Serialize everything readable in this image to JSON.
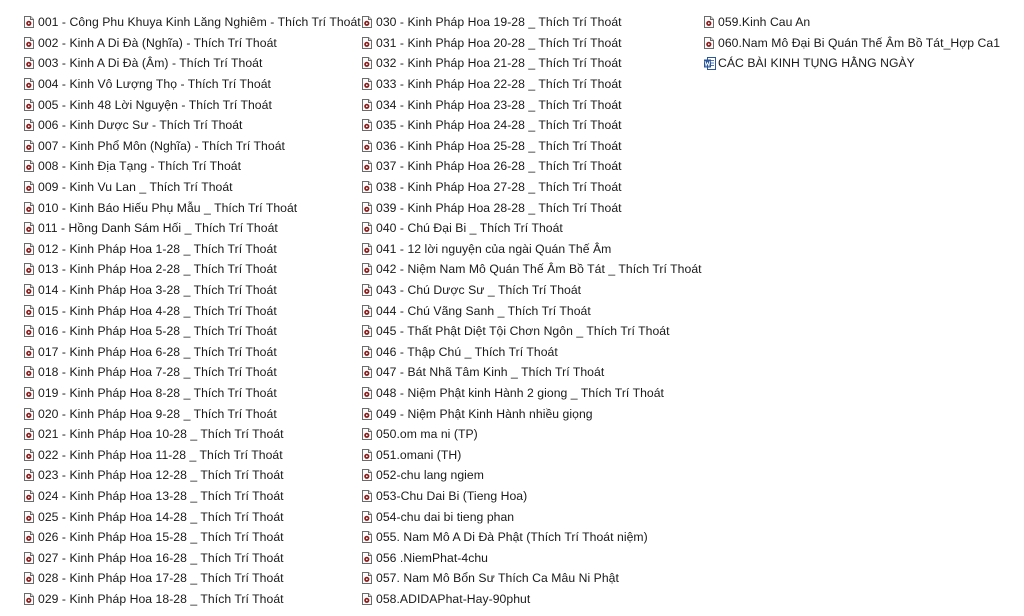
{
  "file_list": {
    "columns": [
      {
        "items": [
          {
            "name": "001 - Công Phu Khuya Kinh Lăng Nghiêm - Thích Trí Thoát",
            "icon": "audio-file-icon"
          },
          {
            "name": "002 - Kinh A Di Đà (Nghĩa) - Thích Trí Thoát",
            "icon": "audio-file-icon"
          },
          {
            "name": "003 - Kinh A Di Đà (Âm) - Thích Trí Thoát",
            "icon": "audio-file-icon"
          },
          {
            "name": "004 - Kinh Vô Lượng Thọ  - Thích Trí Thoát",
            "icon": "audio-file-icon"
          },
          {
            "name": "005 - Kinh 48 Lời Nguyện - Thích Trí Thoát",
            "icon": "audio-file-icon"
          },
          {
            "name": "006 - Kinh Dược Sư - Thích Trí Thoát",
            "icon": "audio-file-icon"
          },
          {
            "name": "007 - Kinh Phổ Môn (Nghĩa) - Thích Trí Thoát",
            "icon": "audio-file-icon"
          },
          {
            "name": "008 - Kinh Địa Tạng - Thích Trí Thoát",
            "icon": "audio-file-icon"
          },
          {
            "name": "009 - Kinh Vu Lan _ Thích Trí Thoát",
            "icon": "audio-file-icon"
          },
          {
            "name": "010 - Kinh Báo Hiếu Phụ Mẫu _ Thích Trí Thoát",
            "icon": "audio-file-icon"
          },
          {
            "name": "011 - Hồng Danh Sám Hối _ Thích Trí Thoát",
            "icon": "audio-file-icon"
          },
          {
            "name": "012 - Kinh Pháp Hoa 1-28 _ Thích Trí Thoát",
            "icon": "audio-file-icon"
          },
          {
            "name": "013 - Kinh Pháp Hoa 2-28 _ Thích Trí Thoát",
            "icon": "audio-file-icon"
          },
          {
            "name": "014 - Kinh Pháp Hoa 3-28 _ Thích Trí Thoát",
            "icon": "audio-file-icon"
          },
          {
            "name": "015 - Kinh Pháp Hoa 4-28 _ Thích Trí Thoát",
            "icon": "audio-file-icon"
          },
          {
            "name": "016 - Kinh Pháp Hoa 5-28 _ Thích Trí Thoát",
            "icon": "audio-file-icon"
          },
          {
            "name": "017 - Kinh Pháp Hoa 6-28 _ Thích Trí Thoát",
            "icon": "audio-file-icon"
          },
          {
            "name": "018 - Kinh Pháp Hoa 7-28 _ Thích Trí Thoát",
            "icon": "audio-file-icon"
          },
          {
            "name": "019 - Kinh Pháp Hoa 8-28 _ Thích Trí Thoát",
            "icon": "audio-file-icon"
          },
          {
            "name": "020 - Kinh Pháp Hoa 9-28 _ Thích Trí Thoát",
            "icon": "audio-file-icon"
          },
          {
            "name": "021 - Kinh Pháp Hoa 10-28 _ Thích Trí Thoát",
            "icon": "audio-file-icon"
          },
          {
            "name": "022 - Kinh Pháp Hoa 11-28 _ Thích Trí Thoát",
            "icon": "audio-file-icon"
          },
          {
            "name": "023 - Kinh Pháp Hoa 12-28 _ Thích Trí Thoát",
            "icon": "audio-file-icon"
          },
          {
            "name": "024 - Kinh Pháp Hoa 13-28 _ Thích Trí Thoát",
            "icon": "audio-file-icon"
          },
          {
            "name": "025 - Kinh Pháp Hoa 14-28 _ Thích Trí Thoát",
            "icon": "audio-file-icon"
          },
          {
            "name": "026 - Kinh Pháp Hoa 15-28 _ Thích Trí Thoát",
            "icon": "audio-file-icon"
          },
          {
            "name": "027 - Kinh Pháp Hoa 16-28 _ Thích Trí Thoát",
            "icon": "audio-file-icon"
          },
          {
            "name": "028 - Kinh Pháp Hoa 17-28 _ Thích Trí Thoát",
            "icon": "audio-file-icon"
          },
          {
            "name": "029 - Kinh Pháp Hoa 18-28 _ Thích Trí Thoát",
            "icon": "audio-file-icon"
          }
        ]
      },
      {
        "items": [
          {
            "name": "030 - Kinh Pháp Hoa 19-28 _ Thích Trí Thoát",
            "icon": "audio-file-icon"
          },
          {
            "name": "031 - Kinh Pháp Hoa 20-28 _ Thích Trí Thoát",
            "icon": "audio-file-icon"
          },
          {
            "name": "032 - Kinh Pháp Hoa 21-28 _ Thích Trí Thoát",
            "icon": "audio-file-icon"
          },
          {
            "name": "033 - Kinh Pháp Hoa 22-28 _ Thích Trí Thoát",
            "icon": "audio-file-icon"
          },
          {
            "name": "034 - Kinh Pháp Hoa 23-28 _ Thích Trí Thoát",
            "icon": "audio-file-icon"
          },
          {
            "name": "035 - Kinh Pháp Hoa 24-28 _ Thích Trí Thoát",
            "icon": "audio-file-icon"
          },
          {
            "name": "036 - Kinh Pháp Hoa 25-28 _ Thích Trí Thoát",
            "icon": "audio-file-icon"
          },
          {
            "name": "037 - Kinh Pháp Hoa 26-28 _ Thích Trí Thoát",
            "icon": "audio-file-icon"
          },
          {
            "name": "038 - Kinh Pháp Hoa 27-28 _ Thích Trí Thoát",
            "icon": "audio-file-icon"
          },
          {
            "name": "039 - Kinh Pháp Hoa 28-28 _ Thích Trí Thoát",
            "icon": "audio-file-icon"
          },
          {
            "name": "040 - Chú Đại Bi _ Thích Trí Thoát",
            "icon": "audio-file-icon"
          },
          {
            "name": "041 - 12 lời nguyện của ngài Quán Thế Âm",
            "icon": "audio-file-icon"
          },
          {
            "name": "042 - Niệm Nam Mô Quán Thế Âm Bồ Tát _ Thích Trí Thoát",
            "icon": "audio-file-icon"
          },
          {
            "name": "043 - Chú Dược Sư _ Thích Trí Thoát",
            "icon": "audio-file-icon"
          },
          {
            "name": "044 - Chú Vãng Sanh  _ Thích Trí Thoát",
            "icon": "audio-file-icon"
          },
          {
            "name": "045 - Thất Phật Diệt Tội Chơn Ngôn _ Thích Trí Thoát",
            "icon": "audio-file-icon"
          },
          {
            "name": "046 - Thập Chú _ Thích Trí Thoát",
            "icon": "audio-file-icon"
          },
          {
            "name": "047 - Bát Nhã Tâm Kinh _ Thích Trí Thoát",
            "icon": "audio-file-icon"
          },
          {
            "name": "048 - Niệm Phật kinh Hành 2 giong _ Thích Trí Thoát",
            "icon": "audio-file-icon"
          },
          {
            "name": "049 - Niệm Phật Kinh Hành nhiều giọng",
            "icon": "audio-file-icon"
          },
          {
            "name": "050.om ma ni (TP)",
            "icon": "audio-file-icon"
          },
          {
            "name": "051.omani (TH)",
            "icon": "audio-file-icon"
          },
          {
            "name": "052-chu lang ngiem",
            "icon": "audio-file-icon"
          },
          {
            "name": "053-Chu Dai Bi (Tieng Hoa)",
            "icon": "audio-file-icon"
          },
          {
            "name": "054-chu dai bi tieng phan",
            "icon": "audio-file-icon"
          },
          {
            "name": "055. Nam Mô A Di Đà Phật (Thích Trí Thoát niệm)",
            "icon": "audio-file-icon"
          },
          {
            "name": "056 .NiemPhat-4chu",
            "icon": "audio-file-icon"
          },
          {
            "name": "057. Nam Mô Bổn Sư Thích Ca Mâu Ni Phật",
            "icon": "audio-file-icon"
          },
          {
            "name": "058.ADIDAPhat-Hay-90phut",
            "icon": "audio-file-icon"
          }
        ]
      },
      {
        "items": [
          {
            "name": "059.Kinh Cau An",
            "icon": "audio-file-icon"
          },
          {
            "name": "060.Nam Mô Đại Bi Quán Thế Âm Bồ Tát_Hợp Ca1",
            "icon": "audio-file-icon"
          },
          {
            "name": "CÁC BÀI  KINH TỤNG HẰNG NGÀY",
            "icon": "word-document-icon"
          }
        ]
      }
    ]
  },
  "colors": {
    "audio_icon_accent": "#8b1a1a",
    "word_icon_accent": "#2b579a",
    "text": "#1a1a1a",
    "background": "#ffffff"
  }
}
